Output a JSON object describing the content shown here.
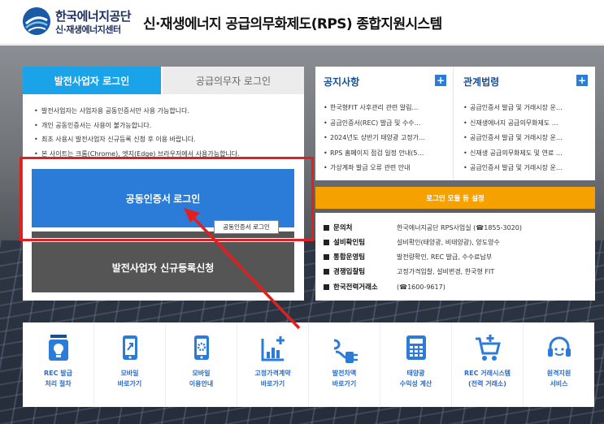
{
  "header": {
    "org_name": "한국에너지공단",
    "org_sub": "신·재생에너지센터",
    "system_title": "신·재생에너지 공급의무화제도(RPS) 종합지원시스템"
  },
  "login": {
    "tab_generator": "발전사업자 로그인",
    "tab_supplier": "공급의무자 로그인",
    "notes": [
      "발전사업자는 사업자용 공동인증서만 사용 가능합니다.",
      "개인 공동인증서는 사용이 불가능합니다.",
      "최초 사용시 발전사업자 신규등록 신청 후 이용 바랍니다.",
      "본 사이트는 크롬(Chrome), 엣지(Edge) 브라우저에서 사용가능합니다."
    ],
    "cert_login": "공동인증서 로그인",
    "tooltip": "공동인증서 로그인",
    "register": "발전사업자 신규등록신청"
  },
  "notice": {
    "title": "공지사항",
    "plus": "+",
    "items": [
      "한국형FIT 사후관리 관련 알림…",
      "공급인증서(REC) 발급 및 수수…",
      "2024년도 상반기 태양광 고정가…",
      "RPS 홈페이지 점검 일정 안내(5…",
      "가상계좌 발급 오류 관련 안내"
    ]
  },
  "laws": {
    "title": "관계법령",
    "plus": "+",
    "items": [
      "공급인증서 발급 및 거래시장 운…",
      "신재생에너지 공급의무화제도 …",
      "공급인증서 발급 및 거래시장 운…",
      "신재생 공급의무화제도 및 연료 …",
      "공급인증서 발급 및 거래시장 운…"
    ]
  },
  "orange_bar": "로그인 모듈 등 설정",
  "contacts": [
    {
      "label": "문의처",
      "value": "한국에너지공단 RPS사업실 (☎1855-3020)"
    },
    {
      "label": "설비확인팀",
      "value": "설비확인(태양광, 비태양광), 양도양수"
    },
    {
      "label": "통합운영팀",
      "value": "발전량확인, REC 발급, 수수료납부"
    },
    {
      "label": "경쟁입찰팀",
      "value": "고정가격입찰, 설비변경, 한국형 FIT"
    },
    {
      "label": "한국전력거래소",
      "value": "(☎1600-9617)"
    }
  ],
  "quick_menu": [
    {
      "label": "REC 발급\n처리 절차",
      "icon": "rec-process-icon"
    },
    {
      "label": "모바일\n바로가기",
      "icon": "mobile-icon"
    },
    {
      "label": "모바일\n이용안내",
      "icon": "mobile-guide-icon"
    },
    {
      "label": "고정가격계약\n바로가기",
      "icon": "chart-plus-icon"
    },
    {
      "label": "발전차액\n바로가기",
      "icon": "plug-icon"
    },
    {
      "label": "태양광\n수익성 계산",
      "icon": "calculator-icon"
    },
    {
      "label": "REC 거래시스템\n(전력 거래소)",
      "icon": "cart-icon"
    },
    {
      "label": "원격지원\n서비스",
      "icon": "headset-icon"
    }
  ],
  "colors": {
    "accent_blue": "#2b7cd8",
    "tab_blue": "#1aa3e8",
    "orange": "#f5a100",
    "highlight_red": "#e02020",
    "dark_gray": "#555555"
  }
}
